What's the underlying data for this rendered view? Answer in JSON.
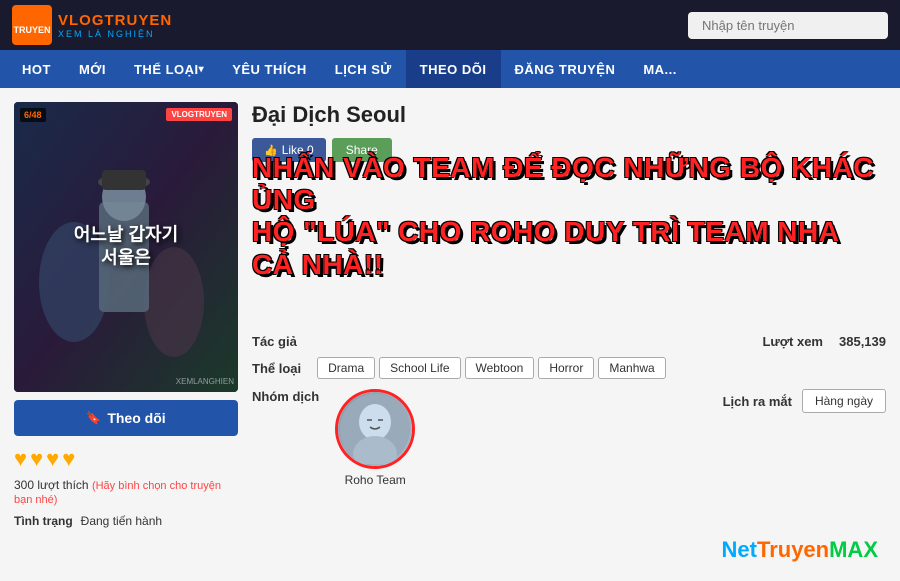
{
  "header": {
    "logo_main": "VLOGTRUYEN",
    "logo_sub": "XEM LÀ NGHIỆN",
    "search_placeholder": "Nhập tên truyện"
  },
  "nav": {
    "items": [
      {
        "label": "HOT"
      },
      {
        "label": "MỚI"
      },
      {
        "label": "THỂ LOẠI",
        "dropdown": true
      },
      {
        "label": "YÊU THÍCH"
      },
      {
        "label": "LỊCH SỬ"
      },
      {
        "label": "THEO DÕI"
      },
      {
        "label": "ĐĂNG TRUYỆN"
      },
      {
        "label": "MA..."
      }
    ]
  },
  "manga": {
    "title": "Đại Dịch Seoul",
    "cover_korean": "어느날 갑자기 서울은",
    "cover_badge": "6/48",
    "like_label": "Like 0",
    "share_label": "Share",
    "overlay_line1": "NHẤN VÀO TEAM ĐỂ ĐỌC NHỮNG BỘ KHÁC ỦNG",
    "overlay_line2": "HỘ \"LÚA\" CHO ROHO DUY TRÌ TEAM NHA CẢ NHÀ!!",
    "author_label": "Tác giả",
    "author_value": "",
    "genre_label": "Thể loại",
    "genres": [
      "Drama",
      "School Life",
      "Webtoon",
      "Horror",
      "Manhwa"
    ],
    "group_label": "Nhóm dịch",
    "group_name": "Roho Team",
    "views_label": "Lượt xem",
    "views_value": "385,139",
    "schedule_label": "Lịch ra mắt",
    "schedule_value": "Hàng ngày",
    "follow_label": "Theo dõi",
    "likes_count": "300 lượt thích",
    "likes_note": "(Hãy bình chọn cho truyện bạn nhé)",
    "status_label": "Tình trạng",
    "status_value": "Đang tiến hành"
  },
  "watermark": {
    "net": "Net",
    "truyen": "Truyen",
    "max": "MAX"
  }
}
